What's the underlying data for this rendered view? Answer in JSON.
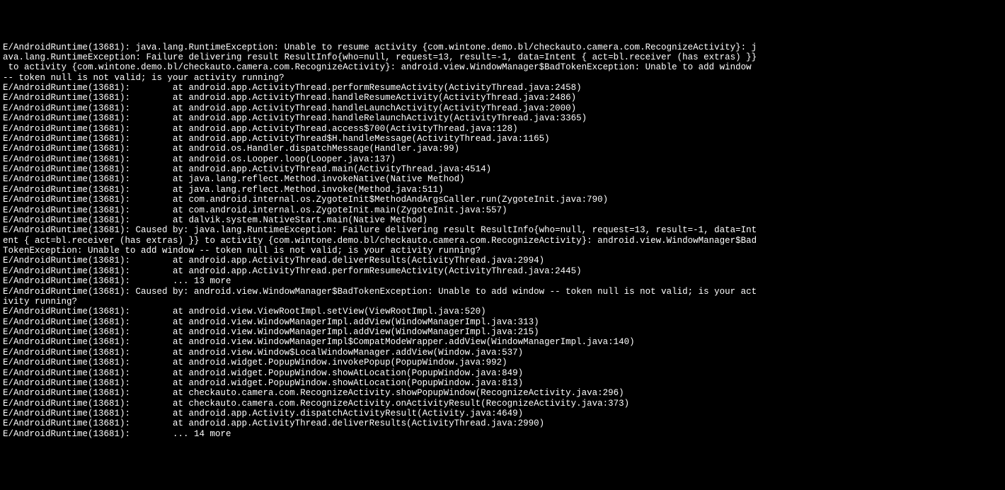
{
  "log": {
    "lines": [
      "E/AndroidRuntime(13681): java.lang.RuntimeException: Unable to resume activity {com.wintone.demo.bl/checkauto.camera.com.RecognizeActivity}: j",
      "ava.lang.RuntimeException: Failure delivering result ResultInfo{who=null, request=13, result=-1, data=Intent { act=bl.receiver (has extras) }}",
      " to activity {com.wintone.demo.bl/checkauto.camera.com.RecognizeActivity}: android.view.WindowManager$BadTokenException: Unable to add window ",
      "-- token null is not valid; is your activity running?",
      "E/AndroidRuntime(13681):        at android.app.ActivityThread.performResumeActivity(ActivityThread.java:2458)",
      "E/AndroidRuntime(13681):        at android.app.ActivityThread.handleResumeActivity(ActivityThread.java:2486)",
      "E/AndroidRuntime(13681):        at android.app.ActivityThread.handleLaunchActivity(ActivityThread.java:2000)",
      "E/AndroidRuntime(13681):        at android.app.ActivityThread.handleRelaunchActivity(ActivityThread.java:3365)",
      "E/AndroidRuntime(13681):        at android.app.ActivityThread.access$700(ActivityThread.java:128)",
      "E/AndroidRuntime(13681):        at android.app.ActivityThread$H.handleMessage(ActivityThread.java:1165)",
      "E/AndroidRuntime(13681):        at android.os.Handler.dispatchMessage(Handler.java:99)",
      "E/AndroidRuntime(13681):        at android.os.Looper.loop(Looper.java:137)",
      "E/AndroidRuntime(13681):        at android.app.ActivityThread.main(ActivityThread.java:4514)",
      "E/AndroidRuntime(13681):        at java.lang.reflect.Method.invokeNative(Native Method)",
      "E/AndroidRuntime(13681):        at java.lang.reflect.Method.invoke(Method.java:511)",
      "E/AndroidRuntime(13681):        at com.android.internal.os.ZygoteInit$MethodAndArgsCaller.run(ZygoteInit.java:790)",
      "E/AndroidRuntime(13681):        at com.android.internal.os.ZygoteInit.main(ZygoteInit.java:557)",
      "E/AndroidRuntime(13681):        at dalvik.system.NativeStart.main(Native Method)",
      "E/AndroidRuntime(13681): Caused by: java.lang.RuntimeException: Failure delivering result ResultInfo{who=null, request=13, result=-1, data=Int",
      "ent { act=bl.receiver (has extras) }} to activity {com.wintone.demo.bl/checkauto.camera.com.RecognizeActivity}: android.view.WindowManager$Bad",
      "TokenException: Unable to add window -- token null is not valid; is your activity running?",
      "E/AndroidRuntime(13681):        at android.app.ActivityThread.deliverResults(ActivityThread.java:2994)",
      "E/AndroidRuntime(13681):        at android.app.ActivityThread.performResumeActivity(ActivityThread.java:2445)",
      "E/AndroidRuntime(13681):        ... 13 more",
      "E/AndroidRuntime(13681): Caused by: android.view.WindowManager$BadTokenException: Unable to add window -- token null is not valid; is your act",
      "ivity running?",
      "E/AndroidRuntime(13681):        at android.view.ViewRootImpl.setView(ViewRootImpl.java:520)",
      "E/AndroidRuntime(13681):        at android.view.WindowManagerImpl.addView(WindowManagerImpl.java:313)",
      "E/AndroidRuntime(13681):        at android.view.WindowManagerImpl.addView(WindowManagerImpl.java:215)",
      "E/AndroidRuntime(13681):        at android.view.WindowManagerImpl$CompatModeWrapper.addView(WindowManagerImpl.java:140)",
      "E/AndroidRuntime(13681):        at android.view.Window$LocalWindowManager.addView(Window.java:537)",
      "E/AndroidRuntime(13681):        at android.widget.PopupWindow.invokePopup(PopupWindow.java:992)",
      "E/AndroidRuntime(13681):        at android.widget.PopupWindow.showAtLocation(PopupWindow.java:849)",
      "E/AndroidRuntime(13681):        at android.widget.PopupWindow.showAtLocation(PopupWindow.java:813)",
      "E/AndroidRuntime(13681):        at checkauto.camera.com.RecognizeActivity.showPopupWindow(RecognizeActivity.java:296)",
      "E/AndroidRuntime(13681):        at checkauto.camera.com.RecognizeActivity.onActivityResult(RecognizeActivity.java:373)",
      "E/AndroidRuntime(13681):        at android.app.Activity.dispatchActivityResult(Activity.java:4649)",
      "E/AndroidRuntime(13681):        at android.app.ActivityThread.deliverResults(ActivityThread.java:2990)",
      "E/AndroidRuntime(13681):        ... 14 more"
    ]
  }
}
